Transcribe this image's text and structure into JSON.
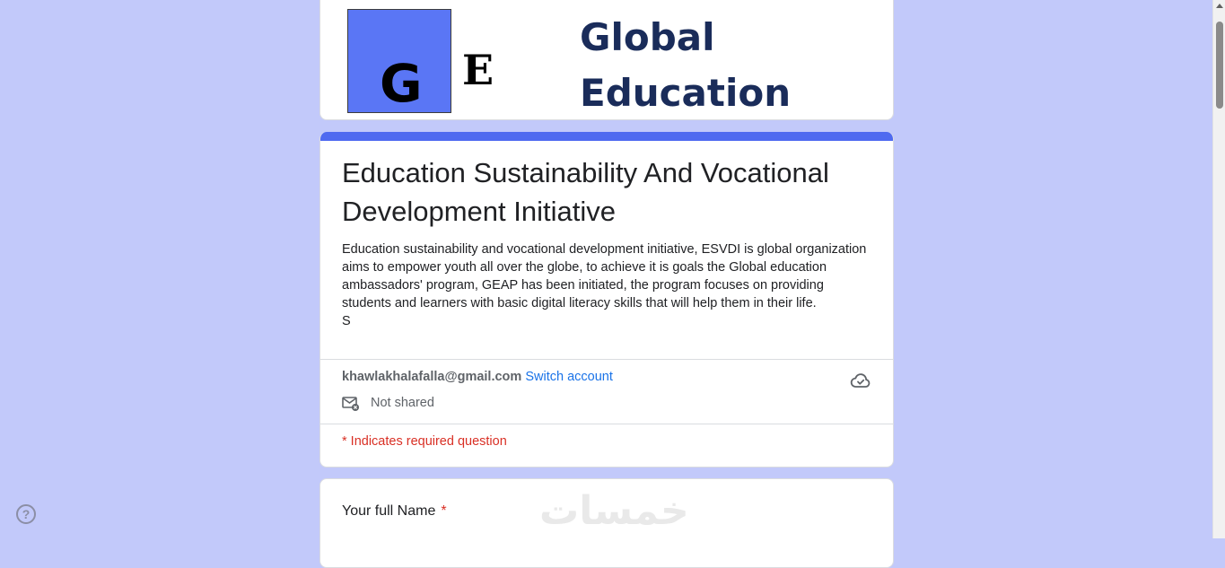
{
  "banner": {
    "logo_g": "G",
    "logo_e": "E",
    "line1": "Global",
    "line2": "Education"
  },
  "form": {
    "title": "Education Sustainability And Vocational Development Initiative",
    "description": "Education sustainability and vocational development initiative, ESVDI is global organization aims to empower youth all over the globe, to achieve it is goals the Global education ambassadors' program, GEAP has been initiated, the program focuses on providing students and learners with basic digital literacy skills that will help them in their life.\nS"
  },
  "account": {
    "email": "khawlakhalafalla@gmail.com",
    "switch_label": "Switch account",
    "shared_label": "Not shared",
    "cloud_icon": "cloud-check-icon"
  },
  "required_note": "* Indicates required question",
  "questions": [
    {
      "label": "Your full Name",
      "required_mark": "*"
    }
  ],
  "watermark": "خمسات",
  "help": {
    "label": "?"
  },
  "colors": {
    "background": "#c2c9fa",
    "accent": "#4f6af0",
    "link": "#1a73e8",
    "required": "#d93025"
  }
}
